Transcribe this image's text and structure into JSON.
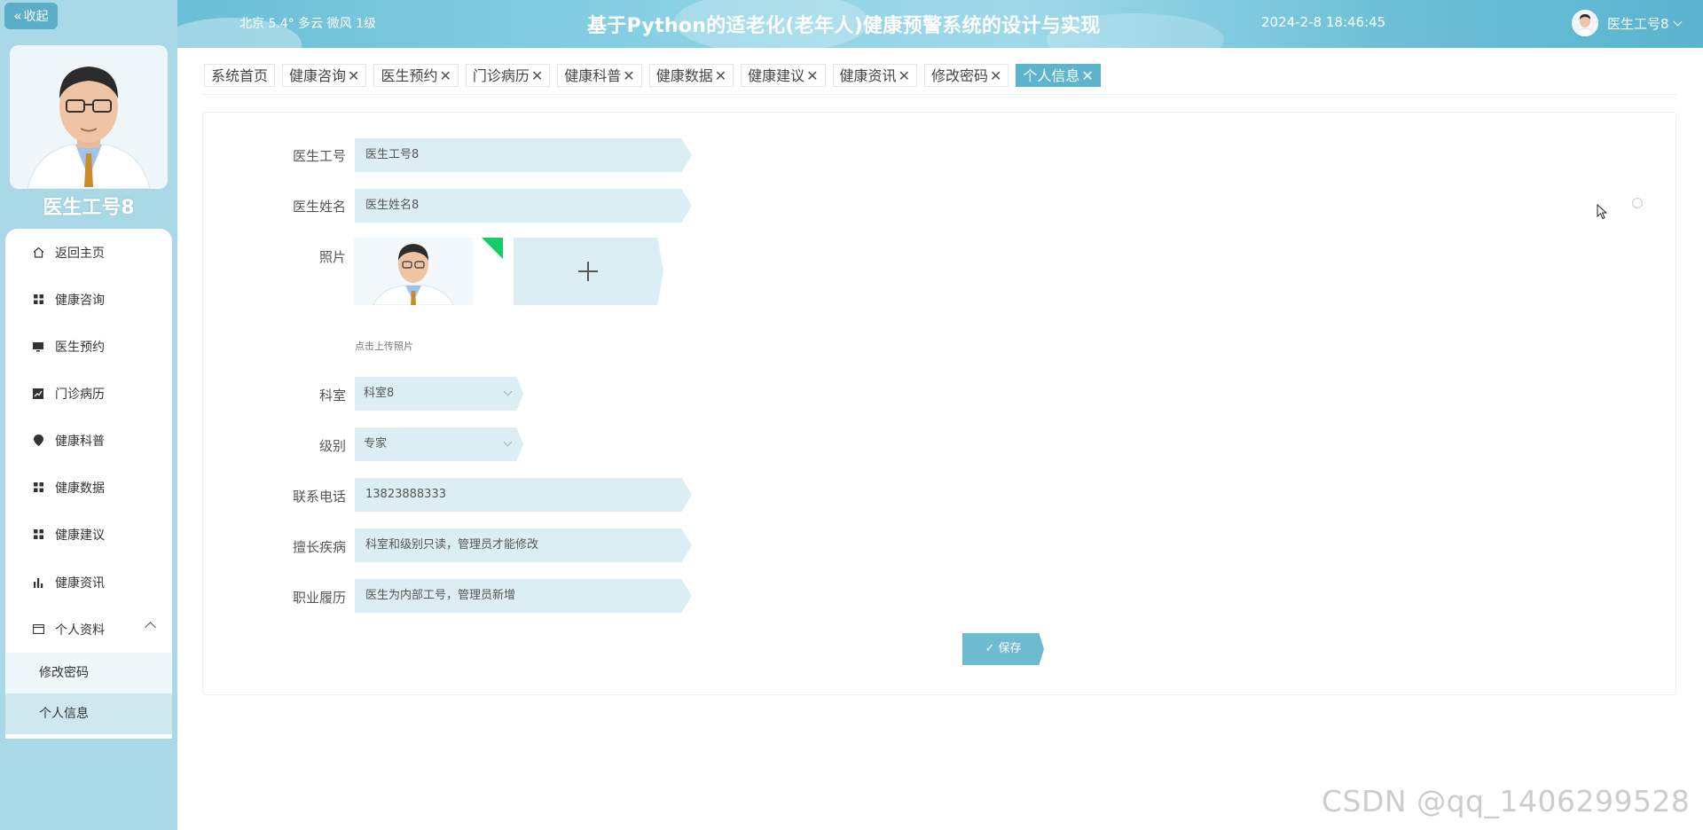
{
  "sidebar": {
    "collapse_label": "收起",
    "user_name": "医生工号8",
    "menu": [
      {
        "label": "返回主页",
        "icon": "home-icon"
      },
      {
        "label": "健康咨询",
        "icon": "grid-icon"
      },
      {
        "label": "医生预约",
        "icon": "monitor-icon"
      },
      {
        "label": "门诊病历",
        "icon": "chart-icon"
      },
      {
        "label": "健康科普",
        "icon": "location-icon"
      },
      {
        "label": "健康数据",
        "icon": "grid-icon"
      },
      {
        "label": "健康建议",
        "icon": "grid-icon"
      },
      {
        "label": "健康资讯",
        "icon": "bar-chart-icon"
      },
      {
        "label": "个人资料",
        "icon": "card-icon"
      }
    ],
    "submenu": [
      {
        "label": "修改密码"
      },
      {
        "label": "个人信息"
      }
    ]
  },
  "header": {
    "weather": "北京  5.4°  多云  微风  1级",
    "title": "基于Python的适老化(老年人)健康预警系统的设计与实现",
    "datetime": "2024-2-8 18:46:45",
    "user": "医生工号8"
  },
  "tabs": [
    {
      "label": "系统首页",
      "closable": false
    },
    {
      "label": "健康咨询",
      "closable": true
    },
    {
      "label": "医生预约",
      "closable": true
    },
    {
      "label": "门诊病历",
      "closable": true
    },
    {
      "label": "健康科普",
      "closable": true
    },
    {
      "label": "健康数据",
      "closable": true
    },
    {
      "label": "健康建议",
      "closable": true
    },
    {
      "label": "健康资讯",
      "closable": true
    },
    {
      "label": "修改密码",
      "closable": true
    },
    {
      "label": "个人信息",
      "closable": true,
      "active": true
    }
  ],
  "tab_close": "✕",
  "form": {
    "doctor_id": {
      "label": "医生工号",
      "value": "医生工号8"
    },
    "doctor_name": {
      "label": "医生姓名",
      "value": "医生姓名8"
    },
    "photo": {
      "label": "照片",
      "tip": "点击上传照片"
    },
    "department": {
      "label": "科室",
      "value": "科室8"
    },
    "level": {
      "label": "级别",
      "value": "专家"
    },
    "phone": {
      "label": "联系电话",
      "value": "13823888333"
    },
    "specialty": {
      "label": "擅长疾病",
      "value": "科室和级别只读，管理员才能修改"
    },
    "career": {
      "label": "职业履历",
      "value": "医生为内部工号，管理员新增"
    },
    "save_label": "保存"
  },
  "watermark": "CSDN @qq_1406299528",
  "colors": {
    "accent": "#5cb5cd",
    "sidebar_bg": "#a9d8e6",
    "input_bg": "#dbeef4",
    "success_corner": "#13ce66"
  }
}
